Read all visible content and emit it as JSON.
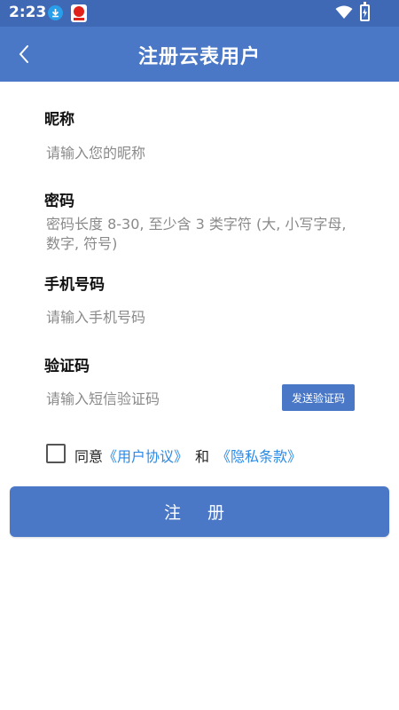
{
  "status_bar": {
    "time": "2:23",
    "icons": [
      "download-notification-icon",
      "app-notification-icon",
      "wifi-icon",
      "battery-charging-icon"
    ]
  },
  "header": {
    "title": "注册云表用户",
    "back_icon": "chevron-left-icon"
  },
  "form": {
    "nickname": {
      "label": "昵称",
      "placeholder": "请输入您的昵称"
    },
    "password": {
      "label": "密码",
      "placeholder": "密码长度 8-30, 至少含 3 类字符 (大, 小写字母, 数字, 符号)"
    },
    "phone": {
      "label": "手机号码",
      "placeholder": "请输入手机号码"
    },
    "code": {
      "label": "验证码",
      "placeholder": "请输入短信验证码",
      "send_label": "发送验证码"
    }
  },
  "agreement": {
    "prefix": "同意",
    "user_agreement": "《用户协议》",
    "and": "和",
    "privacy_policy": "《隐私条款》",
    "checked": false
  },
  "submit_label": "注 册",
  "colors": {
    "status_bar": "#3f68b5",
    "primary": "#4a78c6",
    "link": "#2a8ae8"
  }
}
